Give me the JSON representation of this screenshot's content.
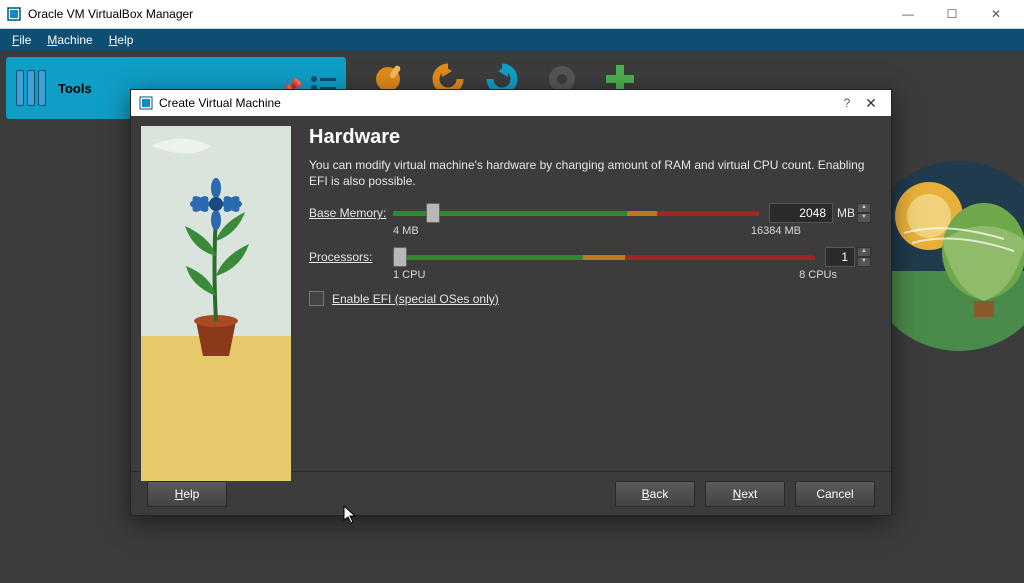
{
  "window": {
    "title": "Oracle VM VirtualBox Manager",
    "menu": {
      "file": "File",
      "machine": "Machine",
      "help": "Help"
    }
  },
  "tools_panel": {
    "label": "Tools"
  },
  "dialog": {
    "title": "Create Virtual Machine",
    "heading": "Hardware",
    "description": "You can modify virtual machine's hardware by changing amount of RAM and virtual CPU count. Enabling EFI is also possible.",
    "memory": {
      "label": "Base Memory:",
      "min_label": "4 MB",
      "max_label": "16384 MB",
      "value": "2048",
      "unit": "MB"
    },
    "cpu": {
      "label": "Processors:",
      "min_label": "1 CPU",
      "max_label": "8 CPUs",
      "value": "1"
    },
    "efi_label": "Enable EFI (special OSes only)",
    "buttons": {
      "help": "Help",
      "back": "Back",
      "next": "Next",
      "cancel": "Cancel"
    }
  }
}
